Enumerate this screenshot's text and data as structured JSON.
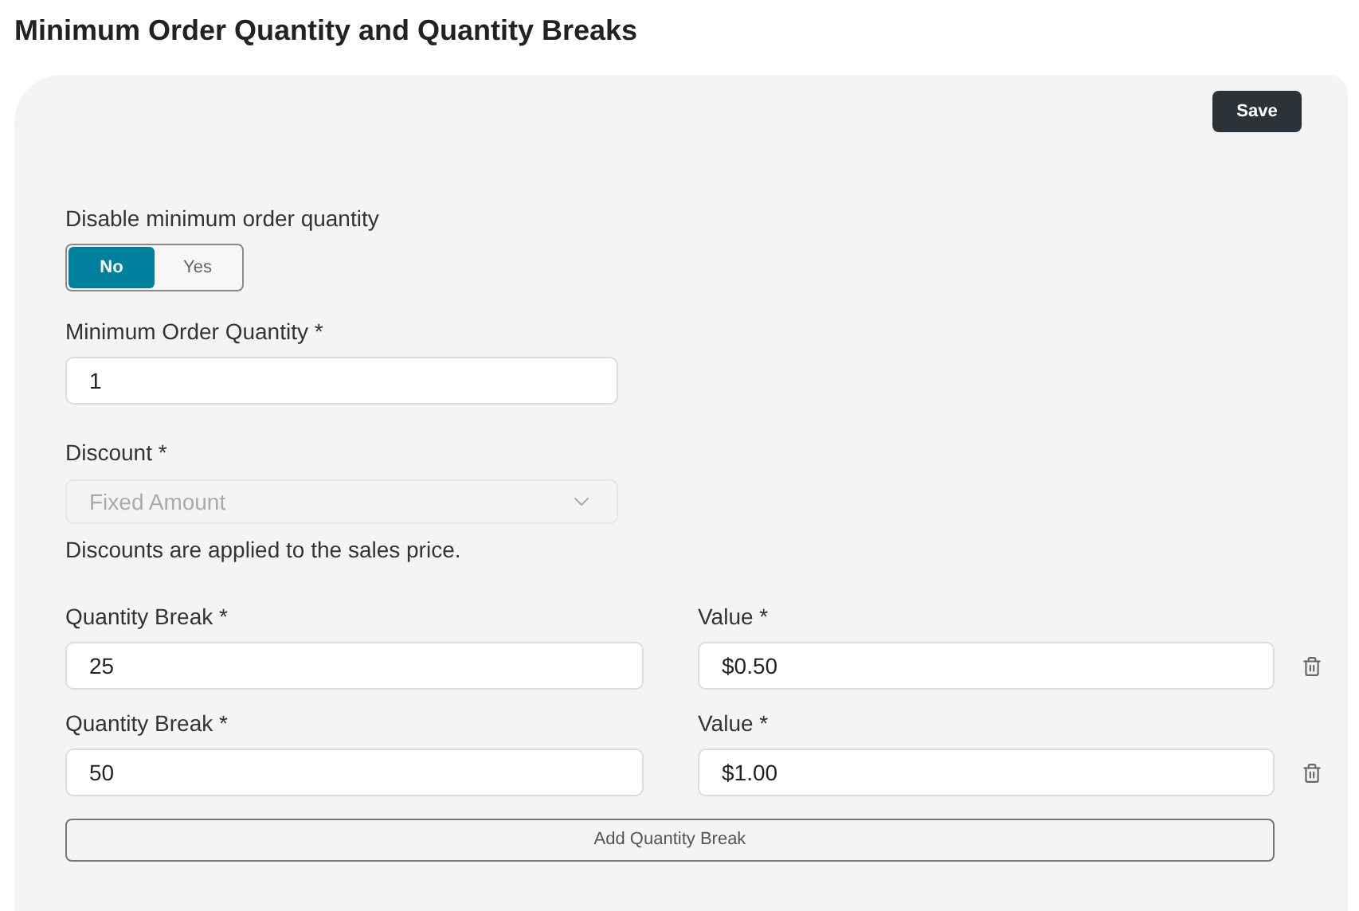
{
  "title": "Minimum Order Quantity and Quantity Breaks",
  "save_button": "Save",
  "disable_moq": {
    "label": "Disable minimum order quantity",
    "options": [
      {
        "label": "No",
        "selected": true
      },
      {
        "label": "Yes",
        "selected": false
      }
    ]
  },
  "min_order_quantity": {
    "label": "Minimum Order Quantity *",
    "value": "1"
  },
  "discount": {
    "label": "Discount *",
    "value": "Fixed Amount",
    "disabled": true
  },
  "discount_note": "Discounts are applied to the sales price.",
  "quantity_breaks": [
    {
      "break_label": "Quantity Break *",
      "break_value": "25",
      "value_label": "Value *",
      "value": "$0.50"
    },
    {
      "break_label": "Quantity Break *",
      "break_value": "50",
      "value_label": "Value *",
      "value": "$1.00"
    }
  ],
  "add_button": "Add Quantity Break"
}
